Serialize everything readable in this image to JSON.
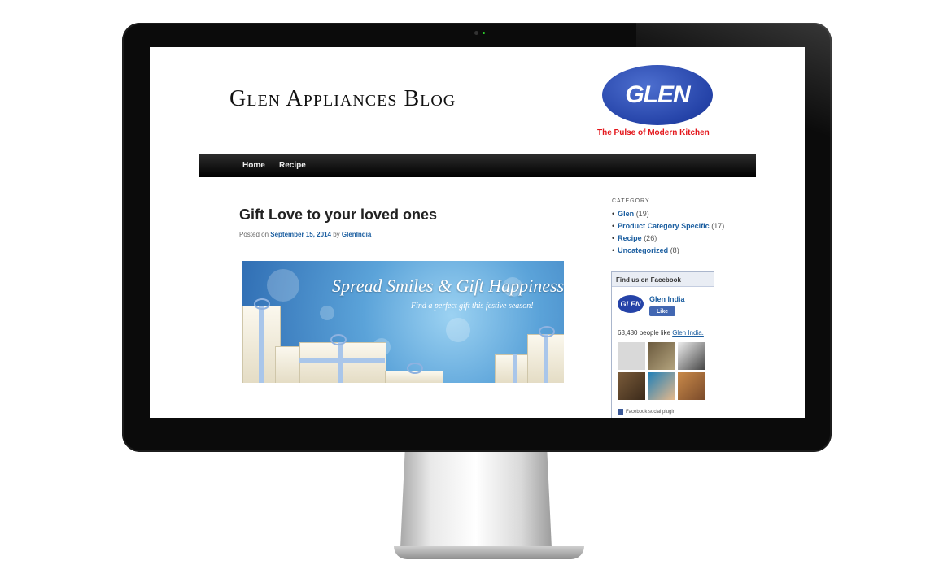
{
  "site": {
    "title": "Glen Appliances Blog",
    "logo_text": "GLEN",
    "tagline": "The Pulse of Modern Kitchen"
  },
  "nav": {
    "items": [
      {
        "label": "Home"
      },
      {
        "label": "Recipe"
      }
    ]
  },
  "post": {
    "title": "Gift Love to your loved ones",
    "meta_prefix": "Posted on",
    "date": "September 15, 2014",
    "by": "by",
    "author": "GlenIndia",
    "banner": {
      "headline": "Spread Smiles & Gift Happiness",
      "subline": "Find a perfect gift this festive season!"
    }
  },
  "sidebar": {
    "category_heading": "CATEGORY",
    "categories": [
      {
        "name": "Glen",
        "count": "(19)"
      },
      {
        "name": "Product Category Specific",
        "count": "(17)"
      },
      {
        "name": "Recipe",
        "count": "(26)"
      },
      {
        "name": "Uncategorized",
        "count": "(8)"
      }
    ],
    "facebook": {
      "header": "Find us on Facebook",
      "page_name": "Glen India",
      "logo_text": "GLEN",
      "like_label": "Like",
      "likes_count": "68,480 people like",
      "likes_page": "Glen India.",
      "plugin_label": "Facebook social plugin"
    }
  },
  "colors": {
    "brand_blue": "#2543a8",
    "tagline_red": "#e3161b",
    "nav_bg": "#000000",
    "link_blue": "#1b5ea0"
  }
}
